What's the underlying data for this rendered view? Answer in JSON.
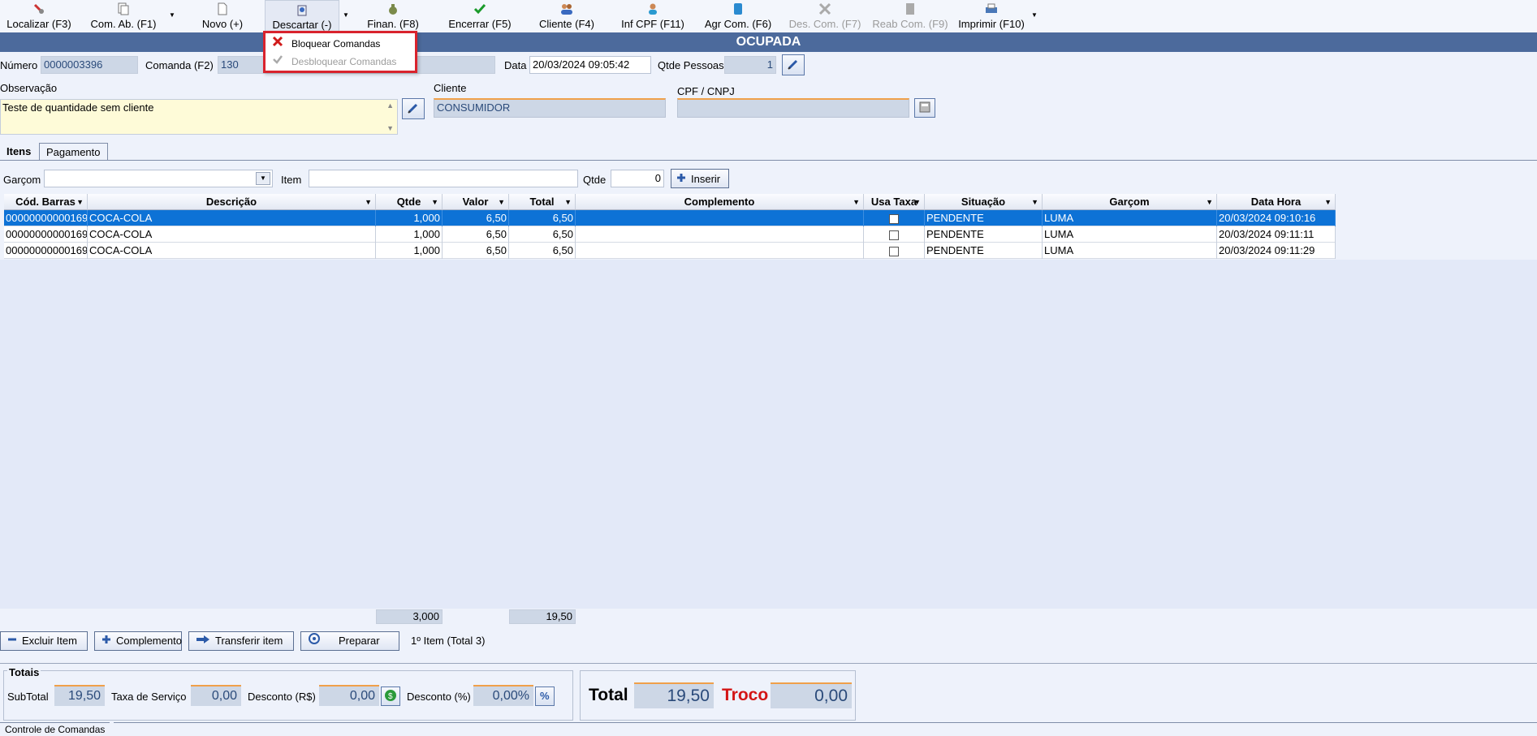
{
  "toolbar": {
    "items": [
      {
        "label": "Localizar (F3)",
        "icon": "search-icon"
      },
      {
        "label": "Com. Ab. (F1)",
        "icon": "documents-icon"
      },
      {
        "label": "Novo (+)",
        "icon": "new-document-icon"
      },
      {
        "label": "Descartar (-)",
        "icon": "discard-icon"
      },
      {
        "label": "Finan. (F8)",
        "icon": "money-bag-icon"
      },
      {
        "label": "Encerrar (F5)",
        "icon": "checkmark-icon"
      },
      {
        "label": "Cliente (F4)",
        "icon": "people-icon"
      },
      {
        "label": "Inf CPF (F11)",
        "icon": "person-icon"
      },
      {
        "label": "Agr Com. (F6)",
        "icon": "stack-icon"
      },
      {
        "label": "Des. Com. (F7)",
        "icon": "ungroup-icon"
      },
      {
        "label": "Reab Com. (F9)",
        "icon": "reopen-icon"
      },
      {
        "label": "Imprimir (F10)",
        "icon": "printer-icon"
      }
    ]
  },
  "menu": {
    "items": [
      {
        "label": "Bloquear Comandas",
        "icon": "close-x-icon",
        "enabled": true
      },
      {
        "label": "Desbloquear Comandas",
        "icon": "check-icon",
        "enabled": false
      }
    ]
  },
  "status": "OCUPADA",
  "form": {
    "numero_label": "Número",
    "numero_value": "0000003396",
    "comanda_label": "Comanda (F2)",
    "comanda_value": "130",
    "data_label": "Data",
    "data_value": "20/03/2024 09:05:42",
    "qtde_pessoas_label": "Qtde Pessoas",
    "qtde_pessoas_value": "1",
    "observacao_label": "Observação",
    "observacao_value": "Teste de quantidade sem cliente",
    "cliente_label": "Cliente",
    "cliente_value": "CONSUMIDOR",
    "cpf_label": "CPF / CNPJ",
    "cpf_value": ""
  },
  "tabs": [
    "Itens",
    "Pagamento"
  ],
  "item_entry": {
    "garcom_label": "Garçom",
    "item_label": "Item",
    "qtde_label": "Qtde",
    "qtde_value": "0",
    "insert_label": "Inserir"
  },
  "grid": {
    "columns": [
      "Cód. Barras",
      "Descrição",
      "Qtde",
      "Valor",
      "Total",
      "Complemento",
      "Usa Taxa",
      "Situação",
      "Garçom",
      "Data Hora"
    ],
    "rows": [
      {
        "cod": "00000000000169",
        "desc": "COCA-COLA",
        "qtde": "1,000",
        "valor": "6,50",
        "total": "6,50",
        "comp": "",
        "situacao": "PENDENTE",
        "garcom": "LUMA",
        "data": "20/03/2024 09:10:16"
      },
      {
        "cod": "00000000000169",
        "desc": "COCA-COLA",
        "qtde": "1,000",
        "valor": "6,50",
        "total": "6,50",
        "comp": "",
        "situacao": "PENDENTE",
        "garcom": "LUMA",
        "data": "20/03/2024 09:11:11"
      },
      {
        "cod": "00000000000169",
        "desc": "COCA-COLA",
        "qtde": "1,000",
        "valor": "6,50",
        "total": "6,50",
        "comp": "",
        "situacao": "PENDENTE",
        "garcom": "LUMA",
        "data": "20/03/2024 09:11:29"
      }
    ],
    "sum_qtde": "3,000",
    "sum_total": "19,50"
  },
  "actions": {
    "excluir": "Excluir Item",
    "complemento": "Complemento",
    "transferir": "Transferir item",
    "preparar": "Preparar",
    "item_info": "1º Item (Total 3)"
  },
  "totais": {
    "title": "Totais",
    "subtotal_label": "SubTotal",
    "subtotal_value": "19,50",
    "taxa_label": "Taxa de Serviço",
    "taxa_value": "0,00",
    "desc_rs_label": "Desconto (R$)",
    "desc_rs_value": "0,00",
    "desc_pct_label": "Desconto (%)",
    "desc_pct_value": "0,00%",
    "total_label": "Total",
    "total_value": "19,50",
    "troco_label": "Troco",
    "troco_value": "0,00"
  },
  "footer_tab": "Controle de Comandas",
  "colors": {
    "header_bar": "#4c6a9c",
    "selection": "#0d72d6",
    "troco": "#d31515",
    "menu_border": "#d9232d"
  }
}
